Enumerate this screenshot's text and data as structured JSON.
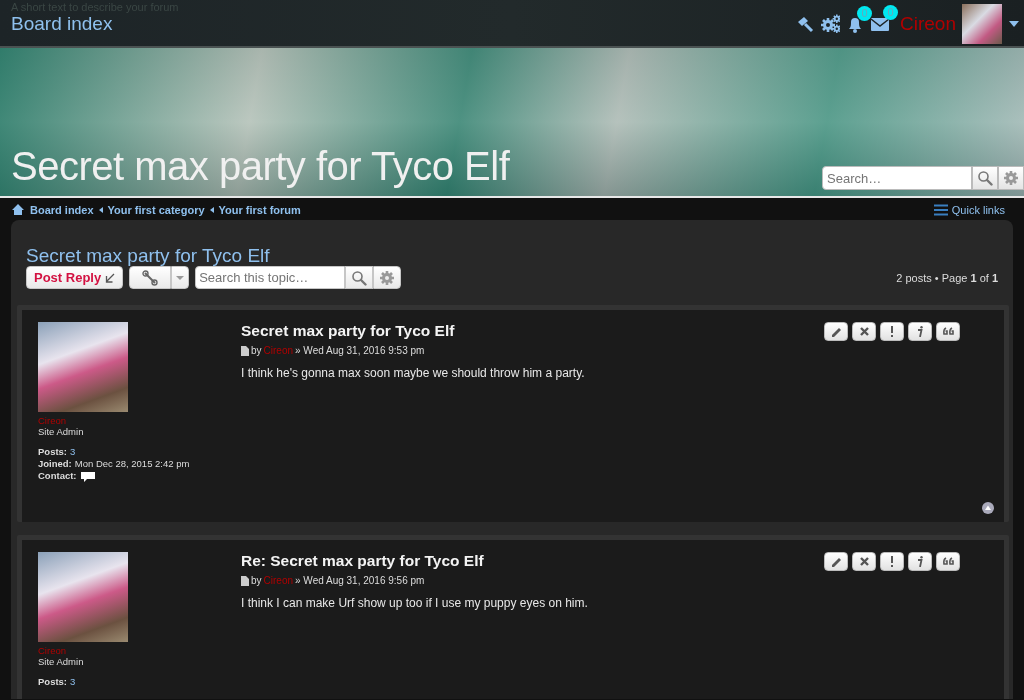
{
  "header": {
    "description": "A short text to describe your forum",
    "home_link": "Board index",
    "notifications_count": "0",
    "messages_count": "0",
    "username": "Cireon",
    "site_title": "Secret max party for Tyco Elf",
    "search": {
      "placeholder": "Search…"
    }
  },
  "breadcrumbs": [
    "Board index",
    "Your first category",
    "Your first forum"
  ],
  "quick_links": "Quick links",
  "topic": {
    "title": "Secret max party for Tyco Elf",
    "post_reply": "Post Reply",
    "search": {
      "placeholder": "Search this topic…"
    },
    "pagination": "2 posts • Page **1** of **1**"
  },
  "posts": [
    {
      "author": "Cireon",
      "rank": "Site Admin",
      "stats": [
        {
          "label": "Posts:",
          "value": "3",
          "kind": "link"
        },
        {
          "label": "Joined:",
          "value": "Mon Dec 28, 2015 2:42 pm",
          "kind": "text"
        },
        {
          "label": "Contact:",
          "kind": "contact"
        }
      ],
      "subject": "Secret max party for Tyco Elf",
      "by": "by",
      "by_author": "Cireon",
      "date": "» Wed Aug 31, 2016 9:53 pm",
      "body": "I think he's gonna max soon maybe we should throw him a party.",
      "back_to_top": true
    },
    {
      "author": "Cireon",
      "rank": "Site Admin",
      "stats": [
        {
          "label": "Posts:",
          "value": "3",
          "kind": "link"
        }
      ],
      "subject": "Re: Secret max party for Tyco Elf",
      "by": "by",
      "by_author": "Cireon",
      "date": "» Wed Aug 31, 2016 9:56 pm",
      "body": "I think I can make Urf show up too if I use my puppy eyes on him.",
      "back_to_top": false
    }
  ]
}
